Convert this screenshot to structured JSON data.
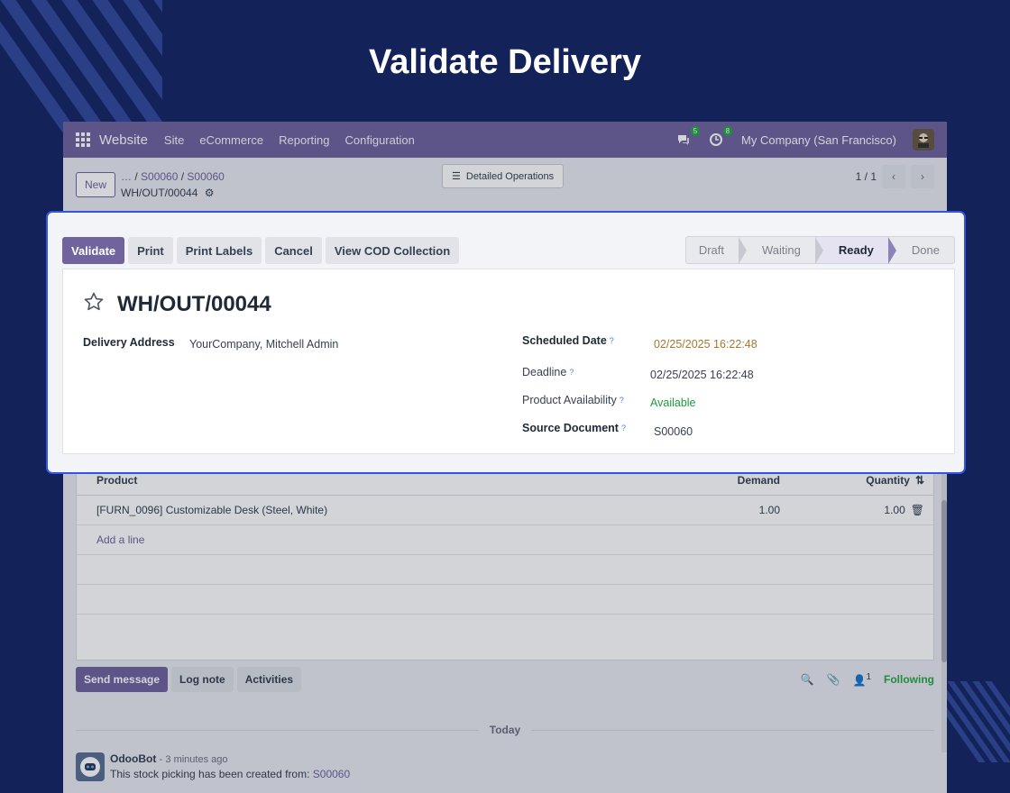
{
  "headline": "Validate Delivery",
  "navbar": {
    "app_name": "Website",
    "menus": [
      "Site",
      "eCommerce",
      "Reporting",
      "Configuration"
    ],
    "messages_count": "5",
    "activities_count": "8",
    "company": "My Company (San Francisco)"
  },
  "control_panel": {
    "new_label": "New",
    "breadcrumb": [
      "…",
      "S00060",
      "S00060"
    ],
    "current_record": "WH/OUT/00044",
    "detailed_operations": "Detailed Operations",
    "pager": "1 / 1"
  },
  "form": {
    "actions": [
      "Validate",
      "Print",
      "Print Labels",
      "Cancel",
      "View COD Collection"
    ],
    "statuses": [
      "Draft",
      "Waiting",
      "Ready",
      "Done"
    ],
    "active_status": "Ready",
    "title": "WH/OUT/00044",
    "delivery_address_label": "Delivery Address",
    "delivery_address": "YourCompany, Mitchell Admin",
    "scheduled_date_label": "Scheduled Date",
    "scheduled_date": "02/25/2025 16:22:48",
    "deadline_label": "Deadline",
    "deadline": "02/25/2025 16:22:48",
    "availability_label": "Product Availability",
    "availability": "Available",
    "source_label": "Source Document",
    "source": "S00060",
    "help_mark": "?"
  },
  "lines": {
    "headers": {
      "product": "Product",
      "demand": "Demand",
      "quantity": "Quantity"
    },
    "rows": [
      {
        "product": "[FURN_0096] Customizable Desk (Steel, White)",
        "demand": "1.00",
        "quantity": "1.00"
      }
    ],
    "add_line": "Add a line"
  },
  "chatter": {
    "send_message": "Send message",
    "log_note": "Log note",
    "activities": "Activities",
    "followers": "1",
    "following": "Following",
    "separator": "Today",
    "author": "OdooBot",
    "time": "- 3 minutes ago",
    "message": "This stock picking has been created from:",
    "message_link": "S00060"
  },
  "colors": {
    "accent": "#71639e",
    "highlight_border": "#3553e6",
    "background": "#13235a",
    "success": "#28a745"
  }
}
